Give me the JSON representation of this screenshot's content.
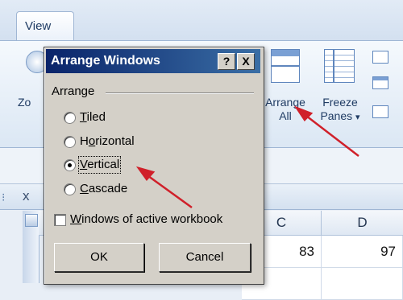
{
  "ribbon": {
    "tab_view": "View",
    "zoom_partial": "Zo",
    "arrange_all": [
      "Arrange",
      "All"
    ],
    "freeze_panes": [
      "Freeze",
      "Panes"
    ],
    "freeze_caret": "▾"
  },
  "sheet": {
    "close_glyph": "x",
    "columns": [
      "C",
      "D"
    ],
    "row1": [
      "83",
      "97"
    ]
  },
  "dialog": {
    "title": "Arrange Windows",
    "help": "?",
    "close": "X",
    "group_label": "Arrange",
    "options": [
      {
        "label": "Tiled",
        "accel": "T",
        "selected": false
      },
      {
        "label": "Horizontal",
        "accel": "o",
        "selected": false
      },
      {
        "label": "Vertical",
        "accel": "V",
        "selected": true
      },
      {
        "label": "Cascade",
        "accel": "C",
        "selected": false
      }
    ],
    "checkbox_label": "Windows of active workbook",
    "checkbox_checked": false,
    "ok": "OK",
    "cancel": "Cancel"
  },
  "colors": {
    "annotation_arrow": "#d0202a",
    "title_bar": "#0a246a"
  }
}
